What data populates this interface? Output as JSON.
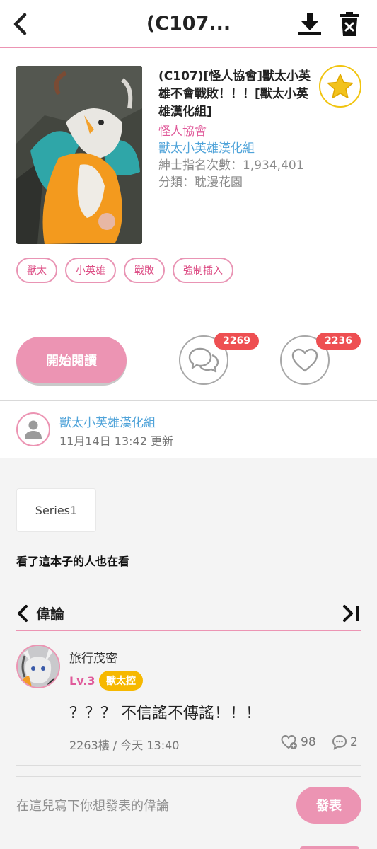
{
  "header": {
    "title": "(C107...",
    "icons": {
      "back": "chevron-left-icon",
      "download": "download-icon",
      "delete": "trash-icon"
    }
  },
  "book": {
    "title": "(C107)[怪人協會]獸太小英雄不會戰敗！！！[獸太小英雄漢化組]",
    "author": "怪人協會",
    "group": "獸太小英雄漢化組",
    "views": "紳士指名次數：1,934,401",
    "category": "分類：耽漫花園",
    "favorite_icon": "star-icon"
  },
  "tags": [
    "獸太",
    "小英雄",
    "戰敗",
    "強制插入"
  ],
  "actions": {
    "read_label": "開始閱讀",
    "comments_count": "2269",
    "likes_count": "2236"
  },
  "uploader": {
    "name": "獸太小英雄漢化組",
    "date": "11月14日 13:42 更新"
  },
  "series": {
    "label": "Series1"
  },
  "also_viewed": "看了這本子的人也在看",
  "comments": {
    "heading": "偉論",
    "items": [
      {
        "user": "旅行茂密",
        "level": "Lv.3",
        "title": "獸太控",
        "text": "？？？ 不信謠不傳謠！！！",
        "meta": "2263樓 / 今天 13:40",
        "likes": "98",
        "replies": "2"
      }
    ]
  },
  "input": {
    "placeholder": "在這兒寫下你想發表的偉論",
    "send_label": "發表"
  },
  "colors": {
    "accent": "#ec94b3",
    "author": "#e05a9a",
    "link": "#4fa3d9",
    "badge": "#ee4f52",
    "title_badge": "#f6b800",
    "star": "#f1c40f"
  }
}
